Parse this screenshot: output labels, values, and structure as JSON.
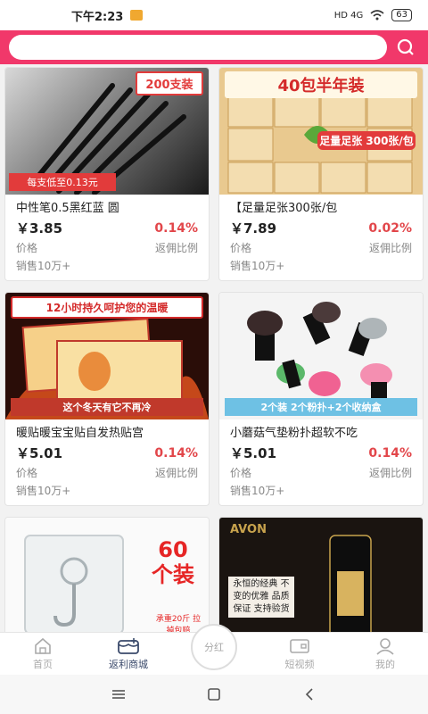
{
  "status_bar": {
    "time": "下午2:23",
    "network": "HD 4G",
    "battery": "63"
  },
  "search": {
    "placeholder": ""
  },
  "products": [
    {
      "title": "中性笔0.5黑红蓝 圆",
      "price": "￥3.85",
      "rate": "0.14%",
      "price_label": "价格",
      "rate_label": "返佣比例",
      "sales": "销售10万+",
      "img_top": "200支装",
      "img_bottom": "每支低至0.13元"
    },
    {
      "title": "【足量足张300张/包",
      "price": "￥7.89",
      "rate": "0.02%",
      "price_label": "价格",
      "rate_label": "返佣比例",
      "sales": "销售10万+",
      "img_top": "40包半年装",
      "img_bottom": "足量足张 300张/包"
    },
    {
      "title": "暖贴暖宝宝贴自发热贴宫",
      "price": "￥5.01",
      "rate": "0.14%",
      "price_label": "价格",
      "rate_label": "返佣比例",
      "sales": "销售10万+",
      "img_top": "12小时持久呵护您的温暖",
      "img_bottom": "这个冬天有它不再冷"
    },
    {
      "title": "小蘑菇气垫粉扑超软不吃",
      "price": "￥5.01",
      "rate": "0.14%",
      "price_label": "价格",
      "rate_label": "返佣比例",
      "sales": "销售10万+",
      "img_top": "",
      "img_bottom": "2个装 2个粉扑+2个收纳盒"
    },
    {
      "title": "",
      "price": "",
      "rate": "",
      "price_label": "",
      "rate_label": "",
      "sales": "",
      "img_top": "60个装",
      "img_bottom": "承重20斤 拉掉包赔"
    },
    {
      "title": "",
      "price": "",
      "rate": "",
      "price_label": "",
      "rate_label": "",
      "sales": "",
      "img_top": "AVON",
      "img_bottom": "永恒的经典 不变的优雅 品质保证 支持验货"
    }
  ],
  "tabs": [
    {
      "label": "首页"
    },
    {
      "label": "返利商城"
    },
    {
      "label": "分红"
    },
    {
      "label": "短视频"
    },
    {
      "label": "我的"
    }
  ],
  "colors": {
    "brand": "#f1386a",
    "rate": "#e2464a",
    "active_tab": "#3b4a6b"
  }
}
